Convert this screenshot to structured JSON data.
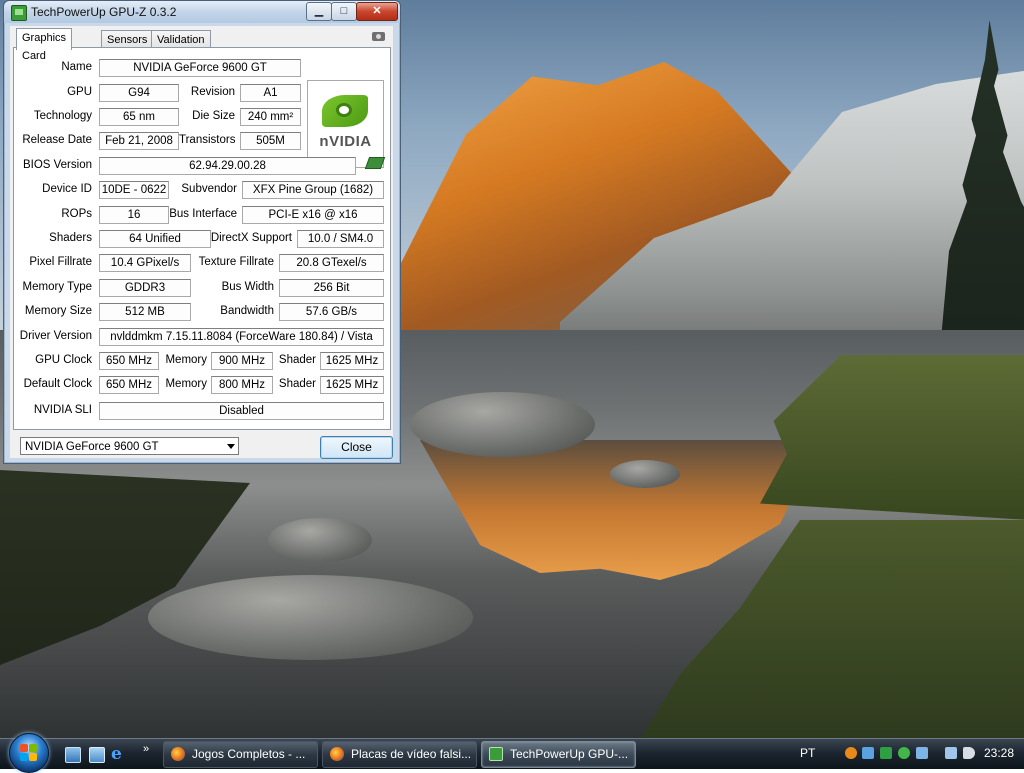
{
  "window": {
    "title": "TechPowerUp GPU-Z 0.3.2",
    "controls": {
      "minimize": "▁",
      "maximize": "□",
      "close": "✕"
    }
  },
  "tabs": [
    {
      "label": "Graphics Card",
      "active": true
    },
    {
      "label": "Sensors",
      "active": false
    },
    {
      "label": "Validation",
      "active": false
    }
  ],
  "logo": {
    "text": "nVIDIA"
  },
  "fields": {
    "name": {
      "label": "Name",
      "value": "NVIDIA GeForce 9600 GT"
    },
    "gpu": {
      "label": "GPU",
      "value": "G94"
    },
    "revision": {
      "label": "Revision",
      "value": "A1"
    },
    "technology": {
      "label": "Technology",
      "value": "65 nm"
    },
    "die_size": {
      "label": "Die Size",
      "value": "240 mm²"
    },
    "release_date": {
      "label": "Release Date",
      "value": "Feb 21, 2008"
    },
    "transistors": {
      "label": "Transistors",
      "value": "505M"
    },
    "bios_version": {
      "label": "BIOS Version",
      "value": "62.94.29.00.28"
    },
    "device_id": {
      "label": "Device ID",
      "value": "10DE - 0622"
    },
    "subvendor": {
      "label": "Subvendor",
      "value": "XFX Pine Group (1682)"
    },
    "rops": {
      "label": "ROPs",
      "value": "16"
    },
    "bus_interface": {
      "label": "Bus Interface",
      "value": "PCI-E x16 @ x16"
    },
    "shaders": {
      "label": "Shaders",
      "value": "64 Unified"
    },
    "directx": {
      "label": "DirectX Support",
      "value": "10.0 / SM4.0"
    },
    "pixel_fillrate": {
      "label": "Pixel Fillrate",
      "value": "10.4 GPixel/s"
    },
    "texture_fillrate": {
      "label": "Texture Fillrate",
      "value": "20.8 GTexel/s"
    },
    "memory_type": {
      "label": "Memory Type",
      "value": "GDDR3"
    },
    "bus_width": {
      "label": "Bus Width",
      "value": "256 Bit"
    },
    "memory_size": {
      "label": "Memory Size",
      "value": "512 MB"
    },
    "bandwidth": {
      "label": "Bandwidth",
      "value": "57.6 GB/s"
    },
    "driver_version": {
      "label": "Driver Version",
      "value": "nvlddmkm 7.15.11.8084 (ForceWare 180.84) / Vista"
    },
    "gpu_clock": {
      "label": "GPU Clock",
      "value": "650 MHz",
      "memory_label": "Memory",
      "memory": "900 MHz",
      "shader_label": "Shader",
      "shader": "1625 MHz"
    },
    "default_clock": {
      "label": "Default Clock",
      "value": "650 MHz",
      "memory_label": "Memory",
      "memory": "800 MHz",
      "shader_label": "Shader",
      "shader": "1625 MHz"
    },
    "sli": {
      "label": "NVIDIA SLI",
      "value": "Disabled"
    }
  },
  "footer": {
    "gpu_select": "NVIDIA GeForce 9600 GT",
    "close_label": "Close"
  },
  "taskbar": {
    "quicklaunch_more": "»",
    "tasks": [
      {
        "label": "Jogos Completos - ..."
      },
      {
        "label": "Placas de vídeo falsi..."
      },
      {
        "label": "TechPowerUp GPU-..."
      }
    ],
    "language": "PT",
    "clock": "23:28"
  },
  "colors": {
    "window_frame": "#c9d9ea",
    "taskbar": "#1d2630",
    "nvidia_green": "#76b900",
    "close_button_red": "#c9452d"
  }
}
